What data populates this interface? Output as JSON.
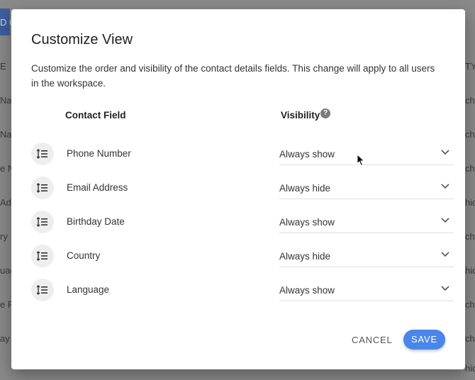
{
  "background": {
    "left_fragments": [
      "D C",
      "E",
      "Nam",
      "Nam",
      "e N",
      "Ad",
      "ry",
      "uag",
      "e P",
      "ay"
    ],
    "right_fragments": [
      "TY",
      "cho",
      "cho",
      "cho",
      "hid",
      "cho",
      "hid",
      "cho",
      "cho",
      "hid"
    ]
  },
  "dialog": {
    "title": "Customize View",
    "description": "Customize the order and visibility of the contact details fields. This change will apply to all users in the workspace.",
    "columns": {
      "field": "Contact Field",
      "visibility": "Visibility",
      "help_glyph": "?"
    },
    "fields": [
      {
        "label": "Phone Number",
        "visibility": "Always show"
      },
      {
        "label": "Email Address",
        "visibility": "Always hide"
      },
      {
        "label": "Birthday Date",
        "visibility": "Always show"
      },
      {
        "label": "Country",
        "visibility": "Always hide"
      },
      {
        "label": "Language",
        "visibility": "Always show"
      }
    ],
    "actions": {
      "cancel": "CANCEL",
      "save": "SAVE"
    }
  },
  "colors": {
    "accent": "#4a86e8",
    "overlay": "#8a8a8a"
  },
  "icons": {
    "drag": "drag-reorder-icon",
    "chevron": "chevron-down-icon",
    "help": "help-icon"
  }
}
